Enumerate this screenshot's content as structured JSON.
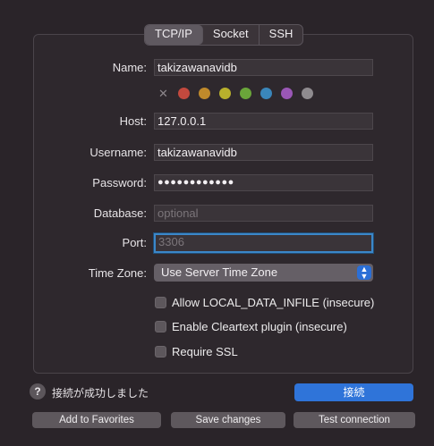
{
  "tabs": [
    {
      "label": "TCP/IP",
      "active": true
    },
    {
      "label": "Socket",
      "active": false
    },
    {
      "label": "SSH",
      "active": false
    }
  ],
  "form": {
    "name_label": "Name:",
    "name_value": "takizawanavidb",
    "host_label": "Host:",
    "host_value": "127.0.0.1",
    "username_label": "Username:",
    "username_value": "takizawanavidb",
    "password_label": "Password:",
    "password_value": "●●●●●●●●●●●●",
    "database_label": "Database:",
    "database_placeholder": "optional",
    "port_label": "Port:",
    "port_placeholder": "3306",
    "timezone_label": "Time Zone:",
    "timezone_value": "Use Server Time Zone"
  },
  "color_tags": {
    "clear_icon": "x-icon",
    "colors": [
      "#c3493e",
      "#c08a2b",
      "#b8b02c",
      "#6aa53a",
      "#3a86ba",
      "#9a57b6",
      "#8f8b8f"
    ]
  },
  "options": {
    "local_infile_label": "Allow LOCAL_DATA_INFILE (insecure)",
    "cleartext_label": "Enable Cleartext plugin (insecure)",
    "ssl_label": "Require SSL"
  },
  "footer": {
    "help_symbol": "?",
    "status_text": "接続が成功しました",
    "connect_label": "接続",
    "add_favorites_label": "Add to Favorites",
    "save_changes_label": "Save changes",
    "test_connection_label": "Test connection"
  },
  "colors": {
    "accent": "#2f74d9",
    "focus_ring": "#3b87c9"
  }
}
